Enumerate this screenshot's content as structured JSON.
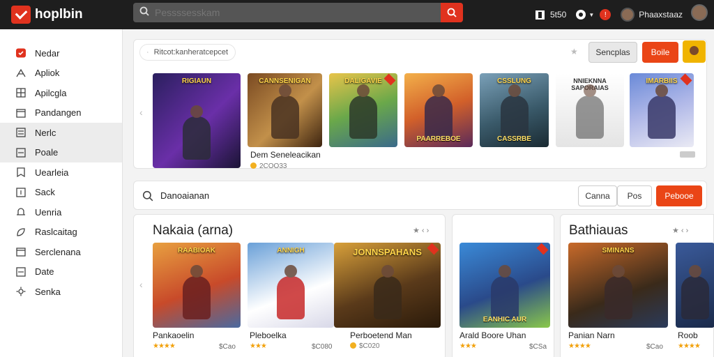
{
  "app": {
    "title": "hoplbin"
  },
  "topbar": {
    "search_placeholder": "Pessssesskam",
    "tray_label": "5t50",
    "notif_count": "!",
    "user_name": "Phaaxstaaz"
  },
  "sidebar": {
    "items": [
      {
        "label": "Nedar",
        "icon": "brand-icon"
      },
      {
        "label": "Apliok",
        "icon": "spark-icon"
      },
      {
        "label": "Apilcgla",
        "icon": "grid-icon"
      },
      {
        "label": "Pandangen",
        "icon": "calendar-icon"
      },
      {
        "label": "Nerlc",
        "icon": "list-icon"
      },
      {
        "label": "Poale",
        "icon": "doc-icon"
      },
      {
        "label": "Uearleia",
        "icon": "bookmark-icon"
      },
      {
        "label": "Sack",
        "icon": "box-icon"
      },
      {
        "label": "Uenria",
        "icon": "bell-icon"
      },
      {
        "label": "Raslcaitag",
        "icon": "tag-icon"
      },
      {
        "label": "Serclenana",
        "icon": "calendar-icon"
      },
      {
        "label": "Date",
        "icon": "doc-icon"
      },
      {
        "label": "Senka",
        "icon": "gear-icon"
      }
    ]
  },
  "featured": {
    "search_placeholder": "Ritcot:kanheratcepcet",
    "btn_grey": "Sencplas",
    "btn_orange": "Boile",
    "thumb_titles": [
      "RIGIAUN",
      "CANNSENIGAN",
      "DALIGAVIE",
      "",
      "CSSLUNG",
      "NNIEKNNA SAPORAIAS",
      "IMARBIIS"
    ],
    "thumb_captions": [
      "",
      "",
      "",
      "PAARREBOE",
      "CASSRBE",
      "",
      ""
    ],
    "first_title": "Dem Seneleacikan",
    "first_meta": "2COO33"
  },
  "search2": {
    "value": "Danoaianan",
    "btn_white1": "Canna",
    "btn_white2": "Pos",
    "btn_orange": "Pebooe"
  },
  "section1": {
    "title": "Nakaia (arna)",
    "cards": [
      {
        "name": "Pankaoelin",
        "price": "$Cao",
        "art": "RAABIOAK"
      },
      {
        "name": "Pleboelka",
        "price": "$C080",
        "art": "ANNIGH"
      },
      {
        "name": "Perboetend Man",
        "price": "$C020",
        "art": "JONNSPAHANS"
      }
    ]
  },
  "section2": {
    "cards": [
      {
        "name": "Arald Boore Uhan",
        "price": "$CSa",
        "art": "EANHIC AUR"
      }
    ]
  },
  "section3": {
    "title": "Bathiauas",
    "cards": [
      {
        "name": "Panian Narn",
        "price": "$Cao",
        "art": "SMINANS"
      },
      {
        "name": "Roob",
        "price": "",
        "art": ""
      }
    ]
  },
  "colors": {
    "accent": "#ea4516",
    "topbar": "#1e1e1e",
    "star": "#f2a10c"
  }
}
